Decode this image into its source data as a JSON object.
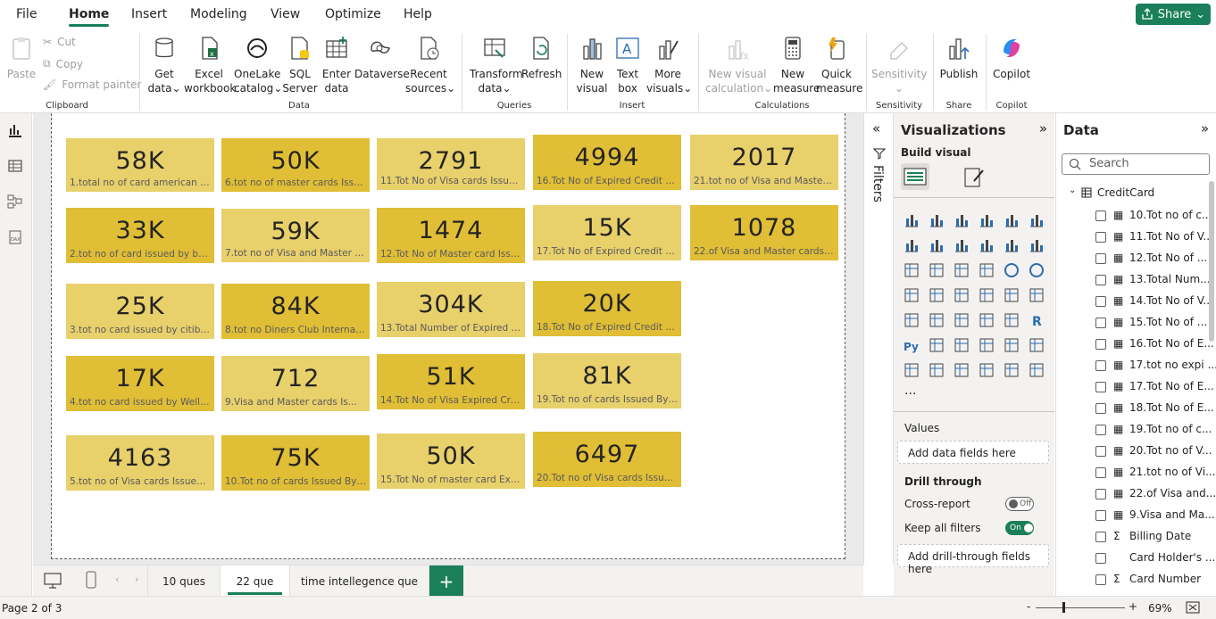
{
  "menu": {
    "items": [
      "File",
      "Home",
      "Insert",
      "Modeling",
      "View",
      "Optimize",
      "Help"
    ],
    "share": "Share"
  },
  "ribbon": {
    "clipboard": {
      "paste": "Paste",
      "cut": "Cut",
      "copy": "Copy",
      "format_painter": "Format painter",
      "group": "Clipboard"
    },
    "data": {
      "get_data": [
        "Get",
        "data"
      ],
      "excel": [
        "Excel",
        "workbook"
      ],
      "onelake": [
        "OneLake",
        "catalog"
      ],
      "sql": [
        "SQL",
        "Server"
      ],
      "enter": [
        "Enter",
        "data"
      ],
      "dataverse": "Dataverse",
      "recent": [
        "Recent",
        "sources"
      ],
      "group": "Data"
    },
    "queries": {
      "transform": [
        "Transform",
        "data"
      ],
      "refresh": "Refresh",
      "group": "Queries"
    },
    "insert": {
      "new_visual": [
        "New",
        "visual"
      ],
      "text_box": [
        "Text",
        "box"
      ],
      "more_visuals": [
        "More",
        "visuals"
      ],
      "group": "Insert"
    },
    "calculations": {
      "new_visual_calc": [
        "New visual",
        "calculation"
      ],
      "new_measure": [
        "New",
        "measure"
      ],
      "quick_measure": [
        "Quick",
        "measure"
      ],
      "group": "Calculations"
    },
    "sensitivity": {
      "label": "Sensitivity",
      "group": "Sensitivity"
    },
    "share": {
      "publish": "Publish",
      "group": "Share"
    },
    "copilot": {
      "label": "Copilot",
      "group": "Copilot"
    }
  },
  "cards": [
    {
      "value": "58K",
      "label": "1.total no of card american exp...",
      "shade": "light"
    },
    {
      "value": "50K",
      "label": "6.tot no of master cards Issued...",
      "shade": "dark"
    },
    {
      "value": "2791",
      "label": "11.Tot No of Visa cards Issued ...",
      "shade": "light"
    },
    {
      "value": "4994",
      "label": "16.Tot No of Expired Credit car...",
      "shade": "dark"
    },
    {
      "value": "2017",
      "label": "21.tot no of Visa and Master c...",
      "shade": "light"
    },
    {
      "value": "33K",
      "label": "2.tot no of card issued by bank...",
      "shade": "dark"
    },
    {
      "value": "59K",
      "label": "7.tot no of Visa and Master car...",
      "shade": "light"
    },
    {
      "value": "1474",
      "label": "12.Tot No of Master card Issue...",
      "shade": "dark"
    },
    {
      "value": "15K",
      "label": "17.Tot No of Expired Credit car...",
      "shade": "light"
    },
    {
      "value": "1078",
      "label": "22.of Visa and Master cards Iss...",
      "shade": "dark"
    },
    {
      "value": "25K",
      "label": "3.tot no card issued by citibank",
      "shade": "light"
    },
    {
      "value": "84K",
      "label": "8.tot no Diners Club Internatio...",
      "shade": "dark"
    },
    {
      "value": "304K",
      "label": "13.Total Number of Expired Cr...",
      "shade": "light"
    },
    {
      "value": "20K",
      "label": "18.Tot No of Expired Credit car...",
      "shade": "dark"
    },
    {
      "value": "17K",
      "label": "4.tot no card issued by Wells F...",
      "shade": "dark"
    },
    {
      "value": "712",
      "label": "9.Visa and Master cards Is...",
      "shade": "light"
    },
    {
      "value": "51K",
      "label": "14.Tot No of Visa Expired Credi...",
      "shade": "dark"
    },
    {
      "value": "81K",
      "label": "19.Tot no of cards Issued By JC...",
      "shade": "light"
    },
    {
      "value": "4163",
      "label": "5.tot no of Visa cards Issued By...",
      "shade": "light"
    },
    {
      "value": "75K",
      "label": "10.Tot no of cards Issued By JC...",
      "shade": "dark"
    },
    {
      "value": "50K",
      "label": "15.Tot No of master card Expir...",
      "shade": "light"
    },
    {
      "value": "6497",
      "label": "20.Tot no of Visa cards Issued ...",
      "shade": "dark"
    }
  ],
  "colors": {
    "card_light": "#e8d06b",
    "card_dark": "#e0be35",
    "accent": "#1a7f5a"
  },
  "filters": {
    "label": "Filters"
  },
  "visualizations": {
    "title": "Visualizations",
    "build_visual": "Build visual",
    "more": "...",
    "values_label": "Values",
    "values_placeholder": "Add data fields here",
    "drill_through": "Drill through",
    "cross_report": "Cross-report",
    "cross_report_state": "Off",
    "keep_filters": "Keep all filters",
    "keep_filters_state": "On",
    "drill_placeholder": "Add drill-through fields here"
  },
  "data_pane": {
    "title": "Data",
    "search_placeholder": "Search",
    "table": "CreditCard",
    "fields": [
      {
        "name": "10.Tot no of c...",
        "icon": "calc"
      },
      {
        "name": "11.Tot No of V...",
        "icon": "calc"
      },
      {
        "name": "12.Tot No of ...",
        "icon": "calc"
      },
      {
        "name": "13.Total Num...",
        "icon": "calc"
      },
      {
        "name": "14.Tot No of V...",
        "icon": "calc"
      },
      {
        "name": "15.Tot No of ...",
        "icon": "calc"
      },
      {
        "name": "16.Tot No of E...",
        "icon": "calc"
      },
      {
        "name": "17.tot no expi ...",
        "icon": "calc"
      },
      {
        "name": "17.Tot No of E...",
        "icon": "calc"
      },
      {
        "name": "18.Tot No of E...",
        "icon": "calc"
      },
      {
        "name": "19.Tot no of c...",
        "icon": "calc"
      },
      {
        "name": "20.Tot no of V...",
        "icon": "calc"
      },
      {
        "name": "21.tot no of Vi...",
        "icon": "calc"
      },
      {
        "name": "22.of Visa and...",
        "icon": "calc"
      },
      {
        "name": "9.Visa and Ma...",
        "icon": "calc"
      },
      {
        "name": "Billing Date",
        "icon": "sigma"
      },
      {
        "name": "Card Holder's ...",
        "icon": "none"
      },
      {
        "name": "Card Number",
        "icon": "sigma"
      }
    ]
  },
  "tabs": [
    "10 ques",
    "22 que",
    "time intellegence que"
  ],
  "active_tab": "22 que",
  "status": {
    "page": "Page 2 of 3",
    "zoom": "69%",
    "zoom_minus": "-",
    "zoom_plus": "+"
  }
}
